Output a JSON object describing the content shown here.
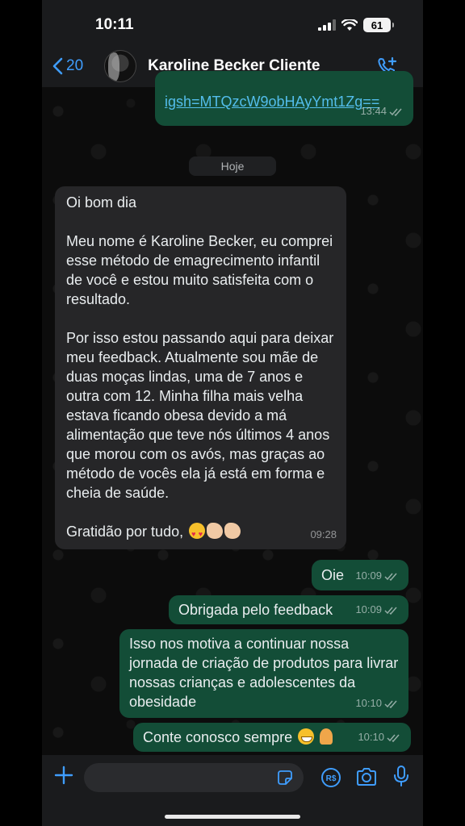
{
  "status_bar": {
    "time": "10:11",
    "battery": "61"
  },
  "header": {
    "back_count": "20",
    "contact_name": "Karoline Becker Cliente"
  },
  "messages": {
    "link": {
      "text": "igsh=MTQzcW9obHAyYmt1Zg==",
      "time": "13:44"
    },
    "date_chip": "Hoje",
    "long": {
      "p1": "Oi bom dia",
      "p2": "Meu nome é Karoline Becker, eu comprei esse método de emagrecimento infantil de você e estou muito satisfeita com o resultado.",
      "p3": "Por isso estou passando aqui para deixar meu feedback. Atualmente sou mãe de duas moças lindas, uma de 7 anos e outra com 12. Minha filha mais velha estava ficando obesa devido a má alimentação que teve nós últimos 4 anos que morou com os avós, mas graças ao método de vocês ela já está em forma e cheia de saúde.",
      "p4": "Gratidão por tudo,",
      "time": "09:28"
    },
    "oie": {
      "text": "Oie",
      "time": "10:09"
    },
    "obrigada": {
      "text": "Obrigada pelo feedback",
      "time": "10:09"
    },
    "isso": {
      "text": "Isso nos motiva a continuar nossa jornada de criação de produtos para livrar nossas crianças e adolescentes da obesidade",
      "time": "10:10"
    },
    "conte": {
      "text": "Conte conosco sempre",
      "time": "10:10"
    }
  },
  "input": {
    "placeholder": ""
  },
  "colors": {
    "accent": "#3f9dfd",
    "outgoing_bubble": "#134d37",
    "incoming_bubble": "#262628",
    "link": "#53bdeb"
  },
  "icons": [
    "back-chevron-icon",
    "add-call-icon",
    "plus-icon",
    "sticker-icon",
    "payment-icon",
    "camera-icon",
    "mic-icon",
    "double-check-icon"
  ]
}
